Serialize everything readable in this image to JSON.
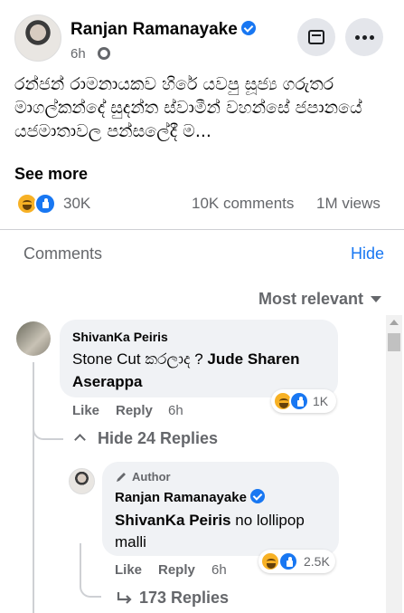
{
  "post": {
    "author": "Ranjan Ramanayake",
    "time": "6h",
    "text": "රන්ජන් රාමනායකව හිරේ යවපු සූජ්‍ය ගරුතර මාගල්කන්දේ සුදන්ත ස්වාමීන් වහන්සේ ජපානයේ යජමාතාවල පන්සලේදී ම...",
    "see_more": "See more",
    "reaction_count": "30K",
    "comments_count": "10K comments",
    "views_count": "1M views"
  },
  "comments_section": {
    "heading": "Comments",
    "hide_label": "Hide",
    "sort_label": "Most relevant"
  },
  "comment1": {
    "name": "ShivanKa Peiris",
    "text": "Stone Cut කරලාද ? ",
    "mention": "Jude Sharen Aserappa",
    "reaction_count": "1K",
    "like": "Like",
    "reply": "Reply",
    "time": "6h",
    "hide_replies": "Hide 24 Replies"
  },
  "reply1": {
    "badge": "Author",
    "name": "Ranjan Ramanayake",
    "mention": "ShivanKa Peiris",
    "text": " no lollipop malli",
    "reaction_count": "2.5K",
    "like": "Like",
    "reply": "Reply",
    "time": "6h",
    "more_replies": "173 Replies"
  },
  "colors": {
    "accent": "#1877f2",
    "muted": "#65676b",
    "bubble": "#f0f2f5"
  },
  "icons": [
    "verified-badge-icon",
    "globe-icon",
    "save-box-icon",
    "more-dots-icon",
    "haha-reaction-icon",
    "like-reaction-icon",
    "caret-down-icon",
    "chevron-up-icon",
    "pen-icon",
    "reply-arrow-icon"
  ]
}
